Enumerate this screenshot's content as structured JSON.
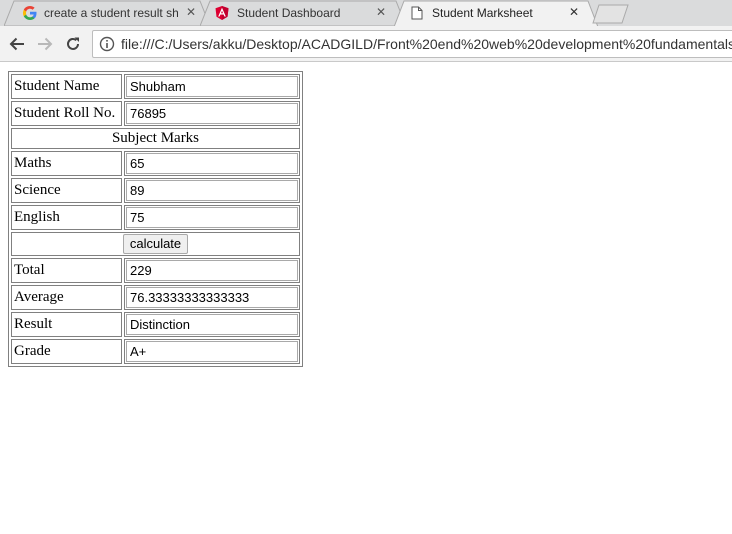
{
  "browser": {
    "tabs": [
      {
        "title": "create a student result sh",
        "icon": "google-g-icon",
        "active": false
      },
      {
        "title": "Student Dashboard",
        "icon": "angular-icon",
        "active": false
      },
      {
        "title": "Student Marksheet",
        "icon": "page-icon",
        "active": true
      }
    ],
    "close_glyph": "✕",
    "url": "file:///C:/Users/akku/Desktop/ACADGILD/Front%20end%20web%20development%20fundamentals%"
  },
  "marksheet": {
    "student_name_label": "Student Name",
    "student_name": "Shubham",
    "roll_label": "Student Roll No.",
    "roll": "76895",
    "subject_header": "Subject Marks",
    "maths_label": "Maths",
    "maths": "65",
    "science_label": "Science",
    "science": "89",
    "english_label": "English",
    "english": "75",
    "calculate_label": "calculate",
    "total_label": "Total",
    "total": "229",
    "average_label": "Average",
    "average": "76.33333333333333",
    "result_label": "Result",
    "result": "Distinction",
    "grade_label": "Grade",
    "grade": "A+"
  }
}
